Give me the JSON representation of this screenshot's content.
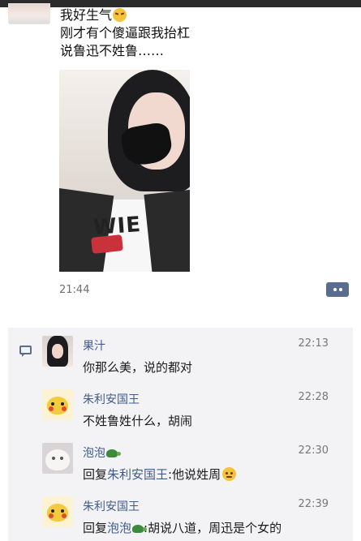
{
  "post": {
    "lines": [
      "我好生气",
      "刚才有个傻逼跟我抬杠",
      "说鲁迅不姓鲁……"
    ],
    "time": "21:44",
    "emoji": "angry-face-icon"
  },
  "comments": [
    {
      "name": "果汁",
      "time": "22:13",
      "text": "你那么美，说的都对"
    },
    {
      "name": "朱利安国王",
      "time": "22:28",
      "text": "不姓鲁姓什么，胡闹"
    },
    {
      "name": "泡泡",
      "time": "22:30",
      "reply_prefix": "回复",
      "reply_to": "朱利安国王",
      "text": ":他说姓周"
    },
    {
      "name": "朱利安国王",
      "time": "22:39",
      "reply_prefix": "回复",
      "reply_to": "泡泡",
      "text": ":胡说八道，周迅是个女的"
    }
  ],
  "colors": {
    "link": "#3f5b8c",
    "panel_bg": "#f3f3f5",
    "accent": "#5a6d8e"
  }
}
